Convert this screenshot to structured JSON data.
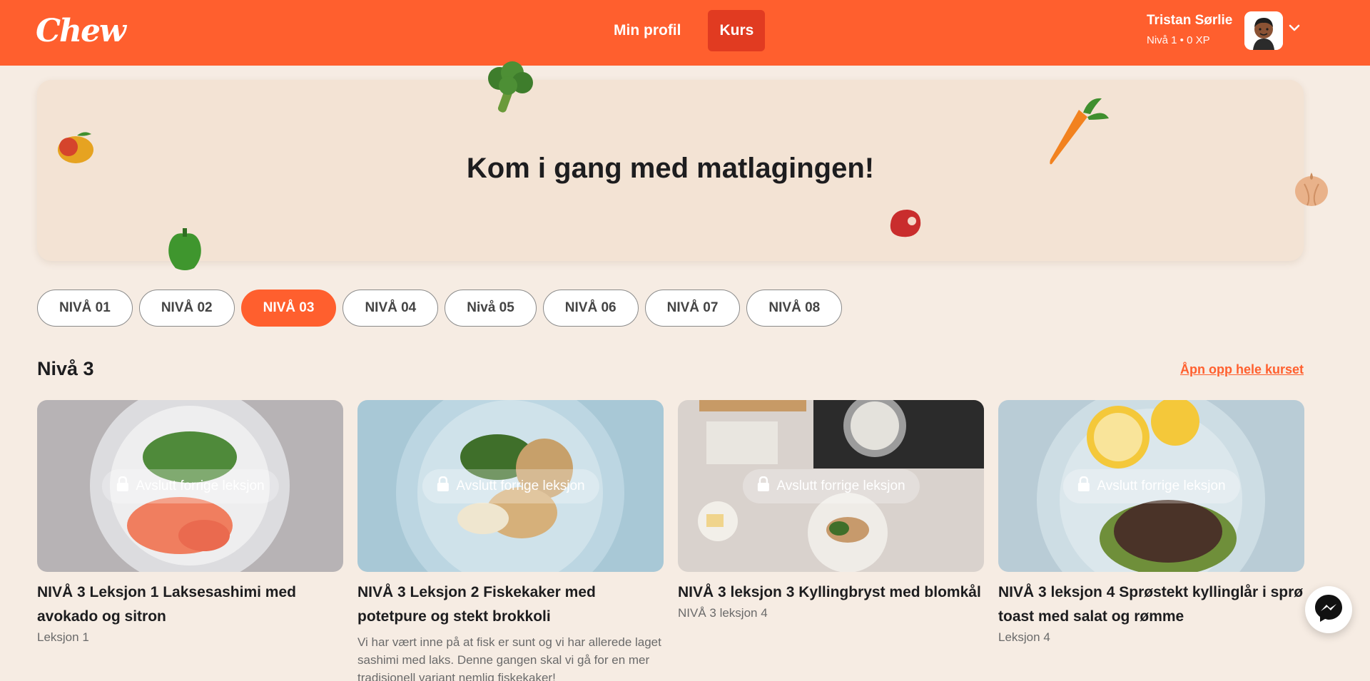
{
  "header": {
    "logo": "Chew",
    "nav": [
      {
        "label": "Min profil",
        "active": false
      },
      {
        "label": "Kurs",
        "active": true
      }
    ],
    "user": {
      "name": "Tristan Sørlie",
      "level": "Nivå 1 • 0 XP"
    }
  },
  "hero": {
    "title": "Kom i gang med matlagingen!"
  },
  "levels": [
    "NIVÅ 01",
    "NIVÅ 02",
    "NIVÅ 03",
    "NIVÅ 04",
    "Nivå 05",
    "NIVÅ 06",
    "NIVÅ 07",
    "NIVÅ 08"
  ],
  "active_level_index": 2,
  "section": {
    "title": "Nivå 3",
    "unlock_label": "Åpn opp hele kurset"
  },
  "lock_label": "Avslutt forrige leksjon",
  "lessons": [
    {
      "title": "NIVÅ 3 Leksjon 1 Laksesashimi med avokado og sitron",
      "sub": "Leksjon 1",
      "desc": ""
    },
    {
      "title": "NIVÅ 3 Leksjon 2 Fiskekaker med potetpure og stekt brokkoli",
      "sub": "",
      "desc": "Vi har vært inne på at fisk er sunt og vi har allerede laget sashimi med laks. Denne gangen skal vi gå for en mer tradisjonell variant nemlig fiskekaker!"
    },
    {
      "title": "NIVÅ 3 leksjon 3 Kyllingbryst med blomkål",
      "sub": "NIVÅ 3 leksjon 4",
      "desc": ""
    },
    {
      "title": "NIVÅ 3 leksjon 4 Sprøstekt kyllinglår i sprø toast med salat og rømme",
      "sub": "Leksjon 4",
      "desc": ""
    }
  ],
  "colors": {
    "brand": "#ff5f2e",
    "active_nav": "#e13b21",
    "background": "#f6ece3",
    "hero": "#f3e3d4"
  }
}
